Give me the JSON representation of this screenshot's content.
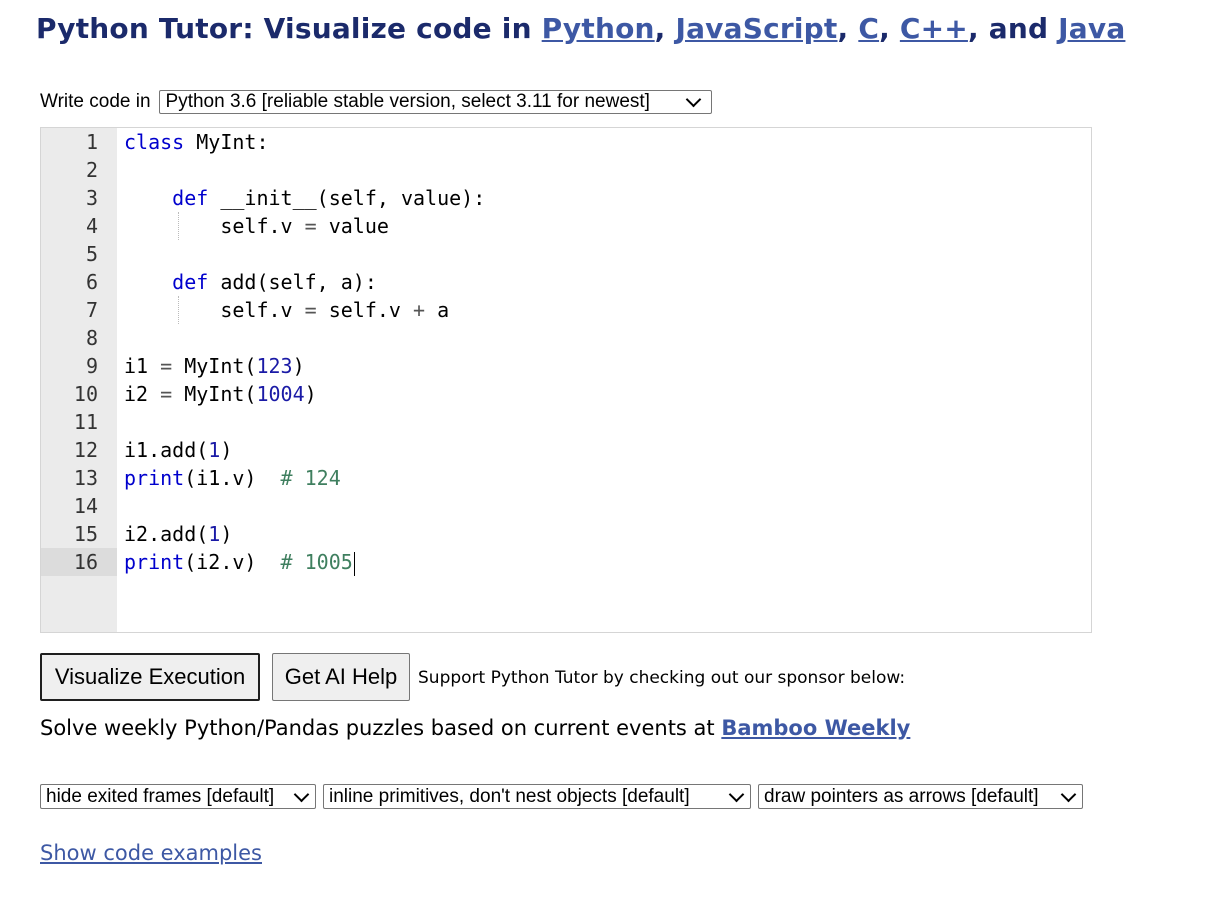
{
  "header": {
    "title_prefix": "Python Tutor: Visualize code in",
    "langs": [
      "Python",
      "JavaScript",
      "C",
      "C++",
      "Java"
    ],
    "sep_comma": ",",
    "sep_and": ", and"
  },
  "language_row": {
    "label": "Write code in",
    "selected": "Python 3.6 [reliable stable version, select 3.11 for newest]"
  },
  "editor": {
    "lines": [
      {
        "n": "1",
        "html": "<span class=\"kw\">class</span> MyInt:"
      },
      {
        "n": "2",
        "html": ""
      },
      {
        "n": "3",
        "html": "    <span class=\"kw\">def</span> __init__(self, value):"
      },
      {
        "n": "4",
        "html": "        self.v <span class=\"op\">=</span> value",
        "guide": true
      },
      {
        "n": "5",
        "html": ""
      },
      {
        "n": "6",
        "html": "    <span class=\"kw\">def</span> add(self, a):"
      },
      {
        "n": "7",
        "html": "        self.v <span class=\"op\">=</span> self.v <span class=\"op\">+</span> a",
        "guide": true
      },
      {
        "n": "8",
        "html": ""
      },
      {
        "n": "9",
        "html": "i1 <span class=\"op\">=</span> MyInt(<span class=\"num\">123</span>)"
      },
      {
        "n": "10",
        "html": "i2 <span class=\"op\">=</span> MyInt(<span class=\"num\">1004</span>)"
      },
      {
        "n": "11",
        "html": ""
      },
      {
        "n": "12",
        "html": "i1.add(<span class=\"num\">1</span>)"
      },
      {
        "n": "13",
        "html": "<span class=\"kw\">print</span>(i1.v)  <span class=\"com\"># 124</span>"
      },
      {
        "n": "14",
        "html": ""
      },
      {
        "n": "15",
        "html": "i2.add(<span class=\"num\">1</span>)"
      },
      {
        "n": "16",
        "html": "<span class=\"kw\">print</span>(i2.v)  <span class=\"com\"># 1005</span><span class=\"caret\"></span>",
        "active": true
      }
    ]
  },
  "buttons": {
    "visualize": "Visualize Execution",
    "ai_help": "Get AI Help"
  },
  "sponsor_text": "Support Python Tutor by checking out our sponsor below:",
  "puzzles": {
    "text": "Solve weekly Python/Pandas puzzles based on current events at",
    "link": "Bamboo Weekly"
  },
  "options": {
    "frames": "hide exited frames [default]",
    "primitives": "inline primitives, don't nest objects [default]",
    "pointers": "draw pointers as arrows [default]"
  },
  "examples_link": "Show code examples",
  "colors": {
    "title": "#1b2a6b",
    "link": "#3d58a4",
    "keyword": "#0000cd",
    "number": "#1a1aa6",
    "comment": "#3f7f5f",
    "gutter": "#ebebeb"
  }
}
